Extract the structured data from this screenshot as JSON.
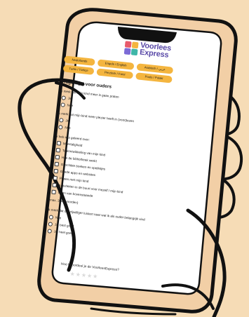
{
  "brand": {
    "name_line1": "Voorlees",
    "name_line2": "Express",
    "mark_colors": [
      "#e85a6b",
      "#f4b53f",
      "#7c6bd6",
      "#3fb6a8"
    ]
  },
  "languages": [
    "Nederlands",
    "Engels / English",
    "Arabisch / عربي",
    "Turks / Türkçe",
    "Perzisch / Farsi",
    "Pools / Polski"
  ],
  "survey": {
    "title": "Vragenlijst voor ouders",
    "questions": [
      {
        "text": "Ik merk dat mijn kind meer is gaan praten",
        "type": "radio",
        "options": [
          "Ja",
          "Nee"
        ]
      },
      {
        "text": "Ik merk dat mijn kind meer plezier heeft in (voor)lezen",
        "type": "radio",
        "options": [
          "Ja",
          "Nee"
        ]
      },
      {
        "text": "Ik heb iets geleerd over:",
        "type": "checkbox",
        "options": [
          "Meertaligheid",
          "Taalontwikkeling van mijn kind",
          "Hoe de bibliotheek werkt",
          "Geschikte boeken en spelletjes",
          "Goede apps en websites",
          "Praten met mijn kind",
          "Activiteiten in de buurt voor mezelf / mijn kind",
          "Geen van bovenstaande"
        ]
      },
      {
        "text": "Ik merk dat de vrijwilliger luistert naar wat ik als ouder belangrijk vind",
        "type": "radio",
        "options": [
          "Nee",
          "Ja, best goed",
          "Ja, heel goed"
        ]
      }
    ],
    "max_note": "(max. 3 antwoorden)",
    "rating_label": "Hoe beoordeel je de VoorleesExpress?",
    "stars": 5
  },
  "colors": {
    "background": "#f6dcb6",
    "phone": "#f2cfa6",
    "accent": "#f4b53f",
    "brand": "#5a4aa8"
  }
}
